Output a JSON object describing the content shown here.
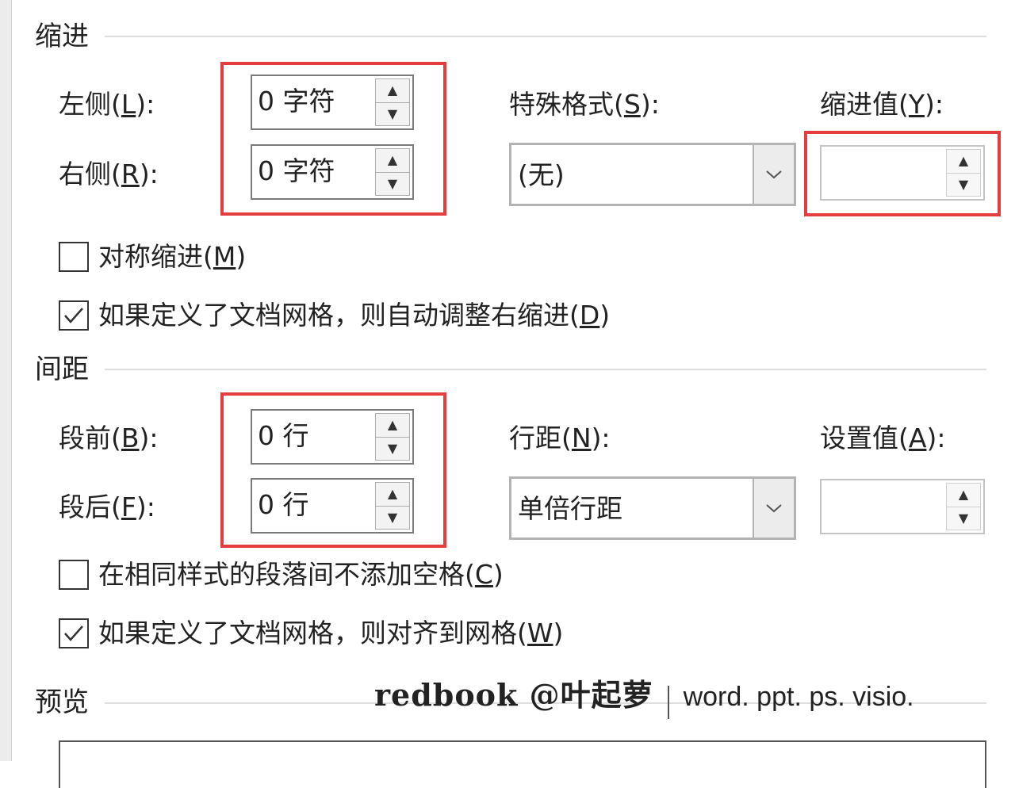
{
  "indent": {
    "title": "缩进",
    "left": {
      "label": "左侧(",
      "key": "L",
      "label_end": "):",
      "value": "0 字符"
    },
    "right": {
      "label": "右侧(",
      "key": "R",
      "label_end": "):",
      "value": "0 字符"
    },
    "special_format": {
      "label": "特殊格式(",
      "key": "S",
      "label_end": "):",
      "selected": "(无)"
    },
    "indent_value": {
      "label": "缩进值(",
      "key": "Y",
      "label_end": "):",
      "value": ""
    },
    "mirror": {
      "label": "对称缩进(",
      "key": "M",
      "label_end": ")",
      "checked": false
    },
    "auto_adjust": {
      "label": "如果定义了文档网格，则自动调整右缩进(",
      "key": "D",
      "label_end": ")",
      "checked": true
    }
  },
  "spacing": {
    "title": "间距",
    "before": {
      "label": "段前(",
      "key": "B",
      "label_end": "):",
      "value": "0 行"
    },
    "after": {
      "label": "段后(",
      "key": "F",
      "label_end": "):",
      "value": "0 行"
    },
    "line_spacing": {
      "label": "行距(",
      "key": "N",
      "label_end": "):",
      "selected": "单倍行距"
    },
    "set_value": {
      "label": "设置值(",
      "key": "A",
      "label_end": "):",
      "value": ""
    },
    "no_space_same_style": {
      "label": "在相同样式的段落间不添加空格(",
      "key": "C",
      "label_end": ")",
      "checked": false
    },
    "snap_to_grid": {
      "label": "如果定义了文档网格，则对齐到网格(",
      "key": "W",
      "label_end": ")",
      "checked": true
    }
  },
  "preview": {
    "title": "预览"
  },
  "watermark": {
    "main": "redbook @叶起萝",
    "tags": "word. ppt. ps. visio."
  },
  "icons": {
    "spin_up": "▲",
    "spin_down": "▼",
    "check": "check-icon",
    "dropdown": "chevron-down-icon"
  },
  "colors": {
    "highlight": "#e33d3d",
    "border": "#7a7a7a"
  }
}
